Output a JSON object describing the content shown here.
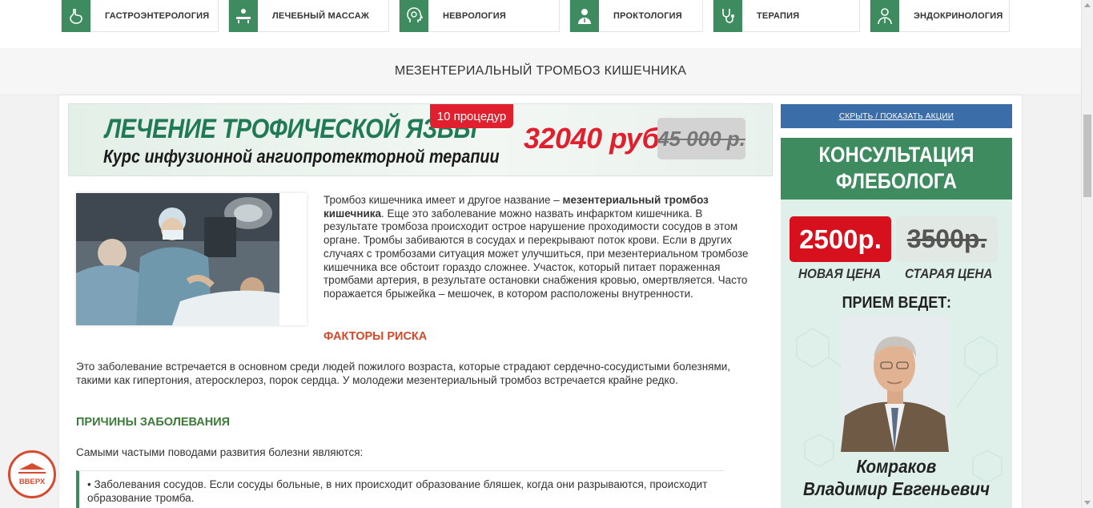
{
  "categories": [
    {
      "label": "ГАСТРОЭНТЕРОЛОГИЯ",
      "icon": "stomach-icon"
    },
    {
      "label": "ЛЕЧЕБНЫЙ МАССАЖ",
      "icon": "massage-icon"
    },
    {
      "label": "НЕВРОЛОГИЯ",
      "icon": "brain-head-icon"
    },
    {
      "label": "ПРОКТОЛОГИЯ",
      "icon": "doctor-icon"
    },
    {
      "label": "ТЕРАПИЯ",
      "icon": "stethoscope-icon"
    },
    {
      "label": "ЭНДОКРИНОЛОГИЯ",
      "icon": "endocrinologist-icon"
    }
  ],
  "page_title": "МЕЗЕНТЕРИАЛЬНЫЙ ТРОМБОЗ КИШЕЧНИКА",
  "banner": {
    "title": "ЛЕЧЕНИЕ ТРОФИЧЕСКОЙ ЯЗВЫ",
    "subtitle": "Курс инфузионной ангиопротекторной терапии",
    "tag": "10 процедур",
    "price": "32040 руб.",
    "old_price": "45 000 р."
  },
  "article": {
    "intro_1": "Тромбоз кишечника имеет и другое название – ",
    "intro_bold": "мезентериальный тромбоз кишечника",
    "intro_2": ". Еще это заболевание можно назвать инфарктом кишечника. В результате тромбоза происходит острое нарушение проходимости сосудов в этом органе. Тромбы забиваются в сосудах и перекрывают поток крови. Если в других случаях с тромбозами ситуация может улучшиться, при мезентериальном тромбозе кишечника все обстоит гораздо сложнее. Участок, который питает пораженная тромбами артерия, в результате остановки снабжения кровью, омертвляется. Часто поражается брыжейка – мешочек, в котором расположены внутренности.",
    "risk_heading": "ФАКТОРЫ РИСКА",
    "risk_text": "Это заболевание встречается в основном среди людей пожилого возраста, которые страдают сердечно-сосудистыми болезнями, такими как гипертония, атеросклероз, порок сердца. У молодежи мезентериальный тромбоз встречается крайне редко.",
    "cause_heading": "ПРИЧИНЫ ЗАБОЛЕВАНИЯ",
    "cause_text": "Самыми частыми поводами развития болезни являются:",
    "bullet_1": "• Заболевания сосудов. Если сосуды больные, в них происходит образование бляшек, когда они разрываются, происходит образование тромба."
  },
  "sidebar": {
    "toggle_label": "СКРЫТЬ / ПОКАЗАТЬ АКЦИИ",
    "promo_line1": "КОНСУЛЬТАЦИЯ",
    "promo_line2": "ФЛЕБОЛОГА",
    "new_price": "2500р.",
    "old_price": "3500р.",
    "new_label": "НОВАЯ ЦЕНА",
    "old_label": "СТАРАЯ ЦЕНА",
    "reception": "ПРИЕМ ВЕДЕТ:",
    "doctor_surname": "Комраков",
    "doctor_name": "Владимир Евгеньевич"
  },
  "up_button": "ВВЕРХ",
  "colors": {
    "accent_green": "#3d8b5e",
    "red": "#d7101e",
    "blue": "#3b6ea8",
    "risk_heading": "#d2492a",
    "cause_heading": "#3d7a3a"
  }
}
